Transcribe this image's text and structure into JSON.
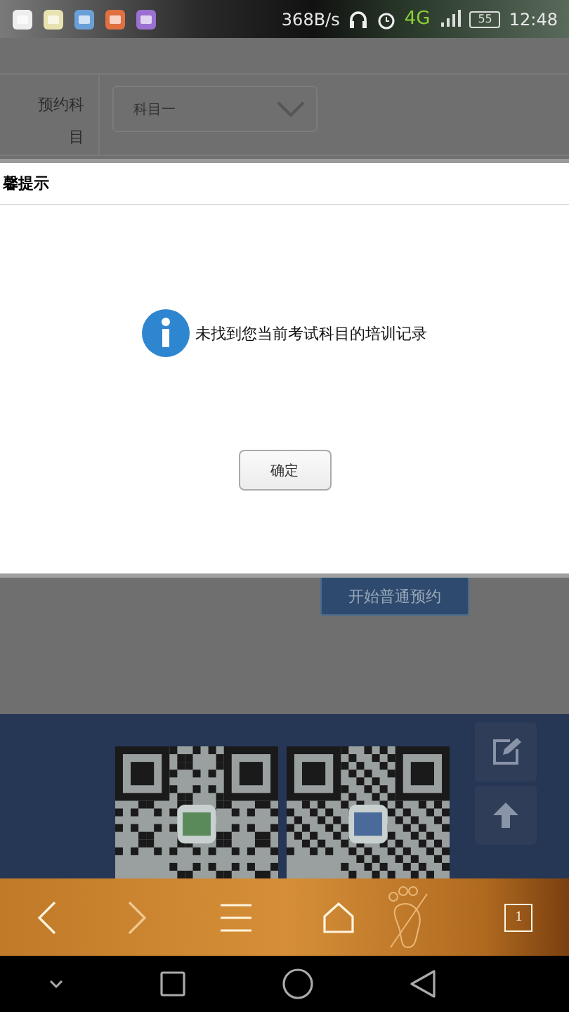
{
  "status_bar": {
    "net_speed": "368B/s",
    "network": "4G",
    "battery": "55",
    "time": "12:48"
  },
  "page": {
    "field_label": "预约科",
    "field_label_tail": "目",
    "subject_select": {
      "value": "科目一"
    },
    "start_button": "开始普通预约"
  },
  "dialog": {
    "title": "馨提示",
    "message": "未找到您当前考试科目的培训记录",
    "ok_button": "确定"
  },
  "browser_toolbar": {
    "tab_count": "1"
  }
}
